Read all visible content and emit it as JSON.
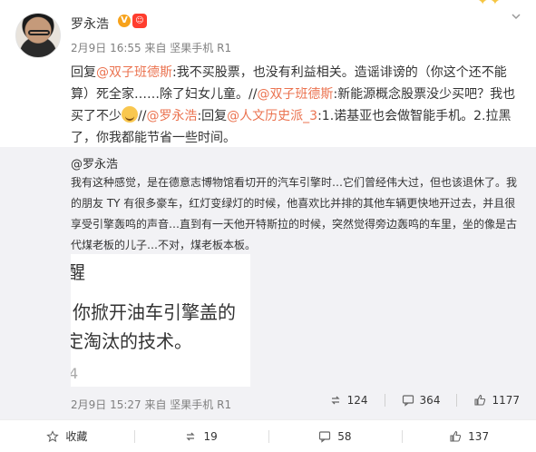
{
  "post": {
    "author": "罗永浩",
    "verified_badge": "V",
    "level_badge": "☺",
    "meta": "2月9日 16:55 来自 坚果手机 R1",
    "text_parts": {
      "p1": "回复",
      "l1": "@双子班德斯",
      "p2": ":我不买股票，也没有利益相关。造谣诽谤的（你这个还不能算）死全家……除了妇女儿童。//",
      "l2": "@双子班德斯",
      "p3": ":新能源概念股票没少买吧？我也买了不少",
      "p4": "//",
      "l3": "@罗永浩",
      "p5": ":回复",
      "l4": "@人文历史派_3",
      "p6": ":1.诺基亚也会做智能手机。2.拉黑了，你我都能节省一些时间。"
    }
  },
  "repost": {
    "author": "@罗永浩",
    "text": "我有这种感觉，是在德意志博物馆看切开的汽车引擎时…它们曾经伟大过，但也该退休了。我的朋友 TY 有很多豪车，红灯变绿灯的时候，他喜欢比并排的其他车辆更快地开过去，并且很享受引擎轰鸣的声音…直到有一天他开特斯拉的时候，突然觉得旁边轰鸣的车里，坐的像是古代煤老板的儿子…不对，煤老板本板。",
    "image_text": {
      "line1": "醒",
      "line2": "你掀开油车引擎盖的",
      "line3": "定淘汰的技术。",
      "line4": "4"
    },
    "meta": "2月9日 15:27 来自 坚果手机 R1",
    "stats": {
      "reposts": "124",
      "comments": "364",
      "likes": "1177"
    }
  },
  "actions": {
    "favorite": "收藏",
    "repost": "19",
    "comment": "58",
    "like": "137"
  },
  "colors": {
    "link": "#eb7350",
    "repost_bg": "#f2f2f5",
    "meta": "#808080"
  },
  "icons": [
    "chevron-down-icon",
    "repost-icon",
    "comment-icon",
    "like-icon",
    "favorite-icon"
  ]
}
